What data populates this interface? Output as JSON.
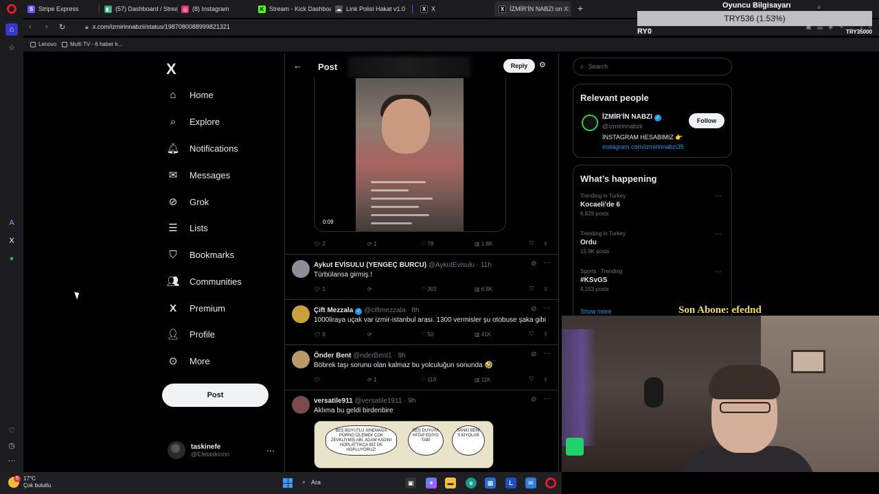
{
  "browser": {
    "tabs": [
      {
        "label": "Stripe Express",
        "color": "#635bff",
        "glyph": "S"
      },
      {
        "label": "(57) Dashboard / Streamla",
        "color": "#2aa87a",
        "glyph": "◧"
      },
      {
        "label": "(8) Instagram",
        "color": "#e1306c",
        "glyph": "◎"
      },
      {
        "label": "Stream - Kick Dashboard",
        "color": "#53fc18",
        "glyph": "K"
      },
      {
        "label": "Link Polisi Hakat v1.0",
        "color": "#555555",
        "glyph": "☁"
      },
      {
        "label": "X",
        "color": "#000000",
        "glyph": "X"
      },
      {
        "label": "İZMİR'İN NABZI on X: \"İzm",
        "color": "#000000",
        "glyph": "X"
      }
    ],
    "url": "x.com/izmirinnabzii/status/1987080088999821321",
    "bookmarks": [
      "Lenovo",
      "Multi TV - 6 haber k..."
    ]
  },
  "x": {
    "logo": "X",
    "nav": [
      {
        "label": "Home",
        "icon": "home-icon",
        "glyph": "⌂"
      },
      {
        "label": "Explore",
        "icon": "search-icon",
        "glyph": "⌕"
      },
      {
        "label": "Notifications",
        "icon": "bell-icon",
        "glyph": "🔔︎"
      },
      {
        "label": "Messages",
        "icon": "envelope-icon",
        "glyph": "✉"
      },
      {
        "label": "Grok",
        "icon": "grok-icon",
        "glyph": "⊘"
      },
      {
        "label": "Lists",
        "icon": "list-icon",
        "glyph": "☰"
      },
      {
        "label": "Bookmarks",
        "icon": "bookmark-icon",
        "glyph": "⛉"
      },
      {
        "label": "Communities",
        "icon": "people-icon",
        "glyph": "👥︎"
      },
      {
        "label": "Premium",
        "icon": "x-premium-icon",
        "glyph": "X"
      },
      {
        "label": "Profile",
        "icon": "person-icon",
        "glyph": "👤︎"
      },
      {
        "label": "More",
        "icon": "more-circle-icon",
        "glyph": "⊙"
      }
    ],
    "post_button": "Post",
    "account": {
      "name": "taskinefe",
      "handle": "@Efetaskinnn"
    },
    "header": {
      "title": "Post",
      "reply_button": "Reply"
    },
    "video": {
      "time": "0:09"
    },
    "main_actions": {
      "replies": "2",
      "reposts": "1",
      "likes": "78",
      "views": "1.8K"
    },
    "replies": [
      {
        "name": "Aykut EVİSULU (YENGEÇ BURCU)",
        "handle": "@AykutEvisulu",
        "time": "11h",
        "verified": false,
        "text": "Türbülansa girmiş.!",
        "replies": "1",
        "reposts": "",
        "likes": "303",
        "views": "6.8K",
        "avatar": "#8a8f97"
      },
      {
        "name": "Çift Mezzala",
        "handle": "@ciftmezzala",
        "time": "8h",
        "verified": true,
        "text": "1000liraya uçak var izmir-istanbul arasi. 1300 vermisler şu otobuse şaka gibi",
        "replies": "8",
        "reposts": "",
        "likes": "50",
        "views": "41K",
        "avatar": "#c9a13a"
      },
      {
        "name": "Önder Bent",
        "handle": "@nderBent1",
        "time": "9h",
        "verified": false,
        "text": "Böbrek taşı sorunu olan kalmaz bu yolculuğun sonunda 🤣",
        "replies": "",
        "reposts": "1",
        "likes": "118",
        "views": "11K",
        "avatar": "#b89a6a"
      },
      {
        "name": "versatile911",
        "handle": "@versatile1911",
        "time": "9h",
        "verified": false,
        "text": "Aklıma bu geldi birdenbire",
        "replies": "",
        "reposts": "",
        "likes": "",
        "views": "",
        "avatar": "#7a4b4b"
      }
    ],
    "comic": {
      "b1": "BEŞ BOYUTLU SİNEMADA PORNO İZLEMEK ÇOK ZEVKLİYMİŞ ABİ. ADAM KADINI HOPLATTIKÇA BİZ DE HOPLUYORUZ!",
      "b2": "BEŞ DUYUYA HİTAP EDİYO TABİ",
      "b3": "SANKİ BENİ S.KIYOLAR"
    },
    "right": {
      "search_placeholder": "Search",
      "relevant_title": "Relevant people",
      "person": {
        "name": "İZMİR'İN NABZI",
        "handle": "@izmirinnabzii",
        "bio": "İNSTAGRAM HESABIMIZ 👉",
        "link": "instagram.com/izmirinnabzi35",
        "follow": "Follow"
      },
      "happening_title": "What’s happening",
      "trends": [
        {
          "context": "Trending in Turkey",
          "name": "Kocaeli'de 6",
          "posts": "6,829 posts"
        },
        {
          "context": "Trending in Turkey",
          "name": "Ordu",
          "posts": "15.9K posts"
        },
        {
          "context": "Sports · Trending",
          "name": "#KSvGS",
          "posts": "4,153 posts"
        }
      ],
      "show_more": "Show more"
    }
  },
  "overlay": {
    "title": "Oyuncu Bilgisayarı",
    "box": "TRY536 (1.53%)",
    "left_text": "RY0",
    "right_text": "TRY35000",
    "subscriber": "Son Abone: efednd"
  },
  "taskbar": {
    "temp": "17°C",
    "condition": "Çok bulutlu",
    "badge": "5",
    "search": "Ara"
  }
}
